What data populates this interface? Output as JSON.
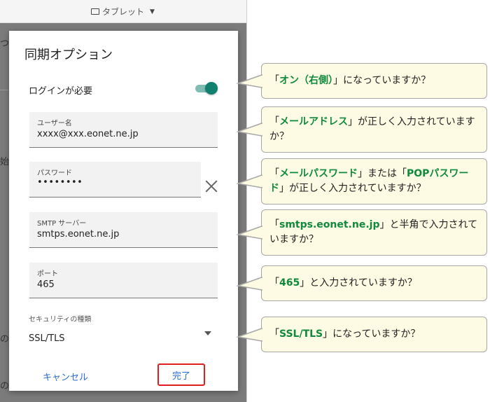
{
  "topbar": {
    "device_label": "タブレット"
  },
  "background_peek": [
    "つ",
    "始",
    "の",
    "の"
  ],
  "dialog": {
    "title": "同期オプション",
    "login_required_label": "ログインが必要",
    "login_required_on": true,
    "fields": {
      "username": {
        "label": "ユーザー名",
        "value": "xxxx@xxx.eonet.ne.jp"
      },
      "password": {
        "label": "パスワード",
        "value": "••••••••"
      },
      "smtp_server": {
        "label": "SMTP サーバー",
        "value": "smtps.eonet.ne.jp"
      },
      "port": {
        "label": "ポート",
        "value": "465"
      }
    },
    "security": {
      "label": "セキュリティの種類",
      "value": "SSL/TLS"
    },
    "cancel_label": "キャンセル",
    "done_label": "完了"
  },
  "callouts": [
    {
      "open": "「",
      "highlight": "オン（右側）",
      "rest": "」になっていますか？"
    },
    {
      "open": "「",
      "highlight": "メールアドレス",
      "rest": "」が正しく入力されていますか？"
    },
    {
      "open": "「",
      "highlight": "メールパスワード",
      "mid": "」または「",
      "highlight2": "POPパスワード",
      "rest": "」が正しく入力されていますか？"
    },
    {
      "open": "「",
      "highlight": "smtps.eonet.ne.jp",
      "rest": "」と半角で入力されていますか？"
    },
    {
      "open": "「",
      "highlight": "465",
      "rest": "」と入力されていますか？"
    },
    {
      "open": "「",
      "highlight": "SSL/TLS",
      "rest": "」になっていますか？"
    }
  ],
  "colors": {
    "highlight": "#0f8a3d",
    "accent_teal": "#12806f",
    "done_outline": "#e01e1e",
    "link_blue": "#2b6cd1"
  }
}
